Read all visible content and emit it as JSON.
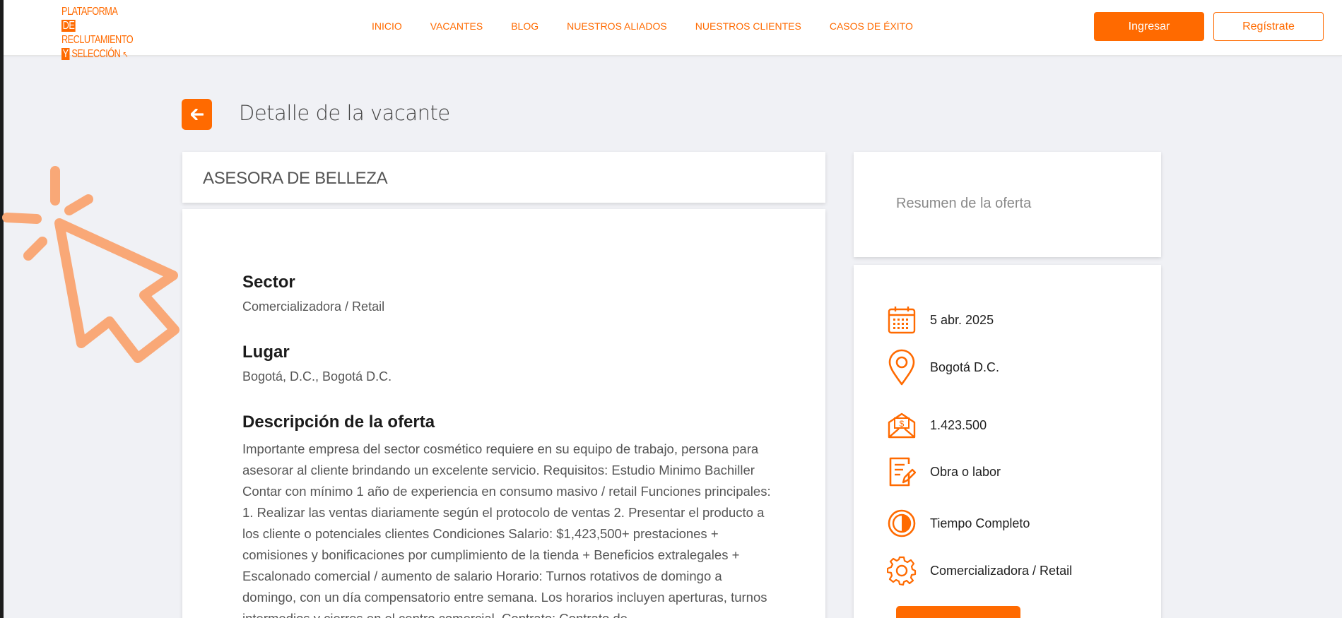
{
  "header": {
    "logo": {
      "line1": "PLATAFORMA",
      "line1_hl": "DE",
      "line2": "RECLUTAMIENTO",
      "line3_hl": "Y",
      "line3": "SELECCIÓN"
    },
    "nav": [
      "INICIO",
      "VACANTES",
      "BLOG",
      "NUESTROS ALIADOS",
      "NUESTROS CLIENTES",
      "CASOS DE ÉXITO"
    ],
    "login_label": "Ingresar",
    "register_label": "Regístrate"
  },
  "page": {
    "title": "Detalle de la vacante"
  },
  "job": {
    "title": "ASESORA DE BELLEZA",
    "sector_heading": "Sector",
    "sector_value": "Comercializadora / Retail",
    "location_heading": "Lugar",
    "location_value": "Bogotá, D.C., Bogotá D.C.",
    "description_heading": "Descripción de la oferta",
    "description": "Importante empresa del sector cosmético requiere en su equipo de trabajo, persona para asesorar al cliente brindando un excelente servicio. Requisitos: Estudio Minimo Bachiller Contar con mínimo 1 año de experiencia en consumo masivo / retail Funciones principales: 1. Realizar las ventas diariamente según el protocolo de ventas 2. Presentar el producto a los cliente o potenciales clientes Condiciones Salario: $1,423,500+ prestaciones + comisiones y bonificaciones por cumplimiento de la tienda + Beneficios extralegales + Escalonado comercial / aumento de salario Horario: Turnos rotativos de domingo a domingo, con un día compensatorio entre semana. Los horarios incluyen aperturas, turnos intermedios y cierres en el centro comercial. Contrato: Contrato de"
  },
  "summary": {
    "title": "Resumen de la oferta",
    "items": [
      {
        "icon": "calendar-icon",
        "label": "5 abr. 2025"
      },
      {
        "icon": "location-pin-icon",
        "label": "Bogotá D.C."
      },
      {
        "icon": "money-envelope-icon",
        "label": "1.423.500"
      },
      {
        "icon": "contract-document-icon",
        "label": "Obra o labor"
      },
      {
        "icon": "half-circle-icon",
        "label": "Tiempo Completo"
      },
      {
        "icon": "gear-icon",
        "label": "Comercializadora / Retail"
      }
    ]
  },
  "colors": {
    "accent": "#ff6a00",
    "background": "#f0f1f5",
    "cursor_overlay": "#f9a877"
  }
}
